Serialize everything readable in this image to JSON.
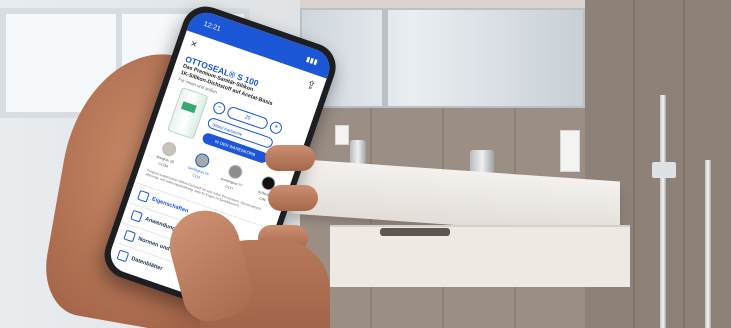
{
  "phone": {
    "status_time": "12:21",
    "close_glyph": "×",
    "share_icon": "share-icon",
    "product_title": "OTTOSEAL® S 100",
    "product_subtitle_1": "Das Premium-Sanitär-Silikon",
    "product_subtitle_2": "1K-Silikon-Dichtstoff auf Acetat-Basis",
    "product_subtitle_3": "Für innen und außen",
    "qty_minus": "−",
    "qty_value": "20",
    "qty_plus": "+",
    "package_select": "300ml Kartusche",
    "cta_label": "IN DEN WARENKORB",
    "colors": [
      {
        "label": "betagrau 18",
        "code": "C1234",
        "hex": "#c9c2b7",
        "selected": false
      },
      {
        "label": "sanitärgrau 16",
        "code": "C116",
        "hex": "#a9aaa8",
        "selected": true
      },
      {
        "label": "zementgrau 77",
        "code": "C177",
        "hex": "#8b8d8f",
        "selected": false
      },
      {
        "label": "schwarz",
        "code": "C04",
        "hex": "#111111",
        "selected": false
      }
    ],
    "description": "Fungizid ausgerüsteter Silikon-Dichtstoff mit sehr hoher Pilzresistenz. Dauerelastisch, alterungs- und witterungsbeständig. Ideal für Fugen im Sanitärbereich.",
    "accordion": [
      {
        "label": "Eigenschaften",
        "icon": "properties-icon"
      },
      {
        "label": "Anwendungsgebiete",
        "icon": "application-icon"
      },
      {
        "label": "Normen und Prüfungen",
        "icon": "norms-icon"
      },
      {
        "label": "Datenblätter",
        "icon": "datasheet-icon"
      }
    ]
  },
  "colors": {
    "brand_blue": "#1a56d6"
  }
}
